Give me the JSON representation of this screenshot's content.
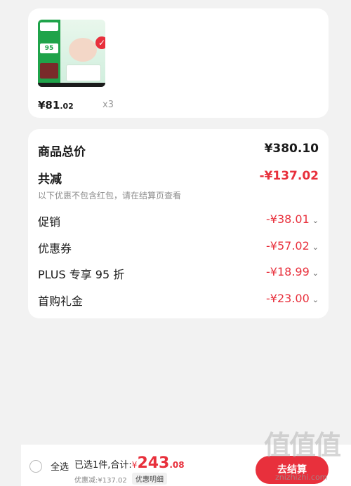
{
  "product": {
    "thumb_price": "95",
    "price_int": "¥81",
    "price_dec": ".02",
    "quantity": "x3"
  },
  "summary": {
    "total_label": "商品总价",
    "total_value": "¥380.10",
    "reduce_label": "共减",
    "reduce_value": "-¥137.02",
    "note": "以下优惠不包含红包，请在结算页查看",
    "items": [
      {
        "label": "促销",
        "value": "-¥38.01"
      },
      {
        "label": "优惠券",
        "value": "-¥57.02"
      },
      {
        "label": "PLUS 专享 95 折",
        "value": "-¥18.99"
      },
      {
        "label": "首购礼金",
        "value": "-¥23.00"
      }
    ]
  },
  "bottom": {
    "select_all": "全选",
    "selected_text": "已选1件,合计:",
    "total_yen": "¥",
    "total_int": "243",
    "total_dec": ".08",
    "discount_text": "优惠减:¥137.02",
    "detail_label": "优惠明细",
    "checkout_label": "去结算"
  },
  "watermark": {
    "text": "值值值",
    "url": "znizhizhi.com"
  },
  "colors": {
    "accent": "#e8303c",
    "background": "#f2f2f2"
  }
}
